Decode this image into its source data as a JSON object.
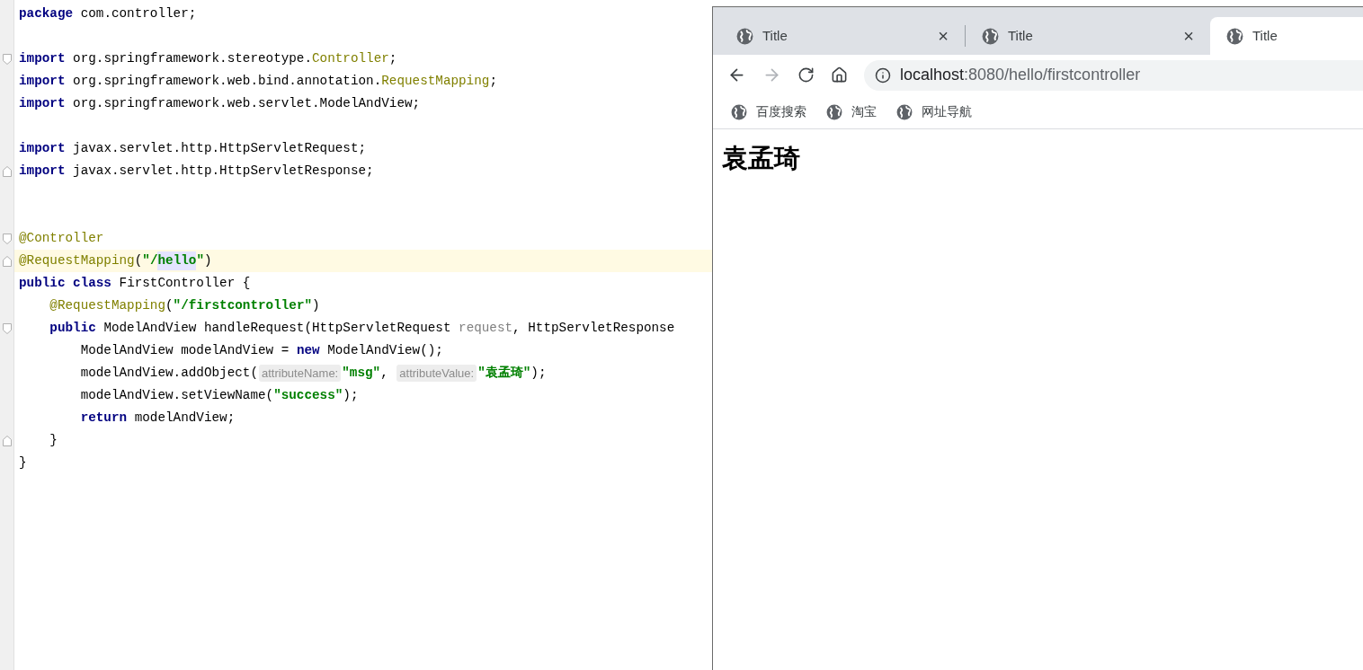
{
  "editor": {
    "lines": [
      {
        "kind": "code",
        "tokens": [
          {
            "kind": "kw",
            "text": "package"
          },
          {
            "kind": "plain",
            "text": " com.controller;"
          }
        ]
      },
      {
        "kind": "blank"
      },
      {
        "kind": "code",
        "fold_start": true,
        "tokens": [
          {
            "kind": "kw",
            "text": "import"
          },
          {
            "kind": "plain",
            "text": " org.springframework.stereotype."
          },
          {
            "kind": "ann",
            "text": "Controller"
          },
          {
            "kind": "plain",
            "text": ";"
          }
        ]
      },
      {
        "kind": "code",
        "tokens": [
          {
            "kind": "kw",
            "text": "import"
          },
          {
            "kind": "plain",
            "text": " org.springframework.web.bind.annotation."
          },
          {
            "kind": "ann",
            "text": "RequestMapping"
          },
          {
            "kind": "plain",
            "text": ";"
          }
        ]
      },
      {
        "kind": "code",
        "tokens": [
          {
            "kind": "kw",
            "text": "import"
          },
          {
            "kind": "plain",
            "text": " org.springframework.web.servlet.ModelAndView;"
          }
        ]
      },
      {
        "kind": "blank"
      },
      {
        "kind": "code",
        "tokens": [
          {
            "kind": "kw",
            "text": "import"
          },
          {
            "kind": "plain",
            "text": " javax.servlet.http.HttpServletRequest;"
          }
        ]
      },
      {
        "kind": "code",
        "fold_end": true,
        "tokens": [
          {
            "kind": "kw",
            "text": "import"
          },
          {
            "kind": "plain",
            "text": " javax.servlet.http.HttpServletResponse;"
          }
        ]
      },
      {
        "kind": "blank"
      },
      {
        "kind": "blank"
      },
      {
        "kind": "code",
        "fold_start": true,
        "tokens": [
          {
            "kind": "ann",
            "text": "@Controller"
          }
        ]
      },
      {
        "kind": "code",
        "fold_end": true,
        "current": true,
        "tokens": [
          {
            "kind": "ann",
            "text": "@RequestMapping"
          },
          {
            "kind": "plain",
            "text": "("
          },
          {
            "kind": "str",
            "text": "\"/"
          },
          {
            "kind": "match",
            "text": "hello"
          },
          {
            "kind": "str",
            "text": "\""
          },
          {
            "kind": "plain",
            "text": ")"
          }
        ]
      },
      {
        "kind": "code",
        "tokens": [
          {
            "kind": "kw",
            "text": "public class"
          },
          {
            "kind": "plain",
            "text": " FirstController {"
          }
        ]
      },
      {
        "kind": "code",
        "tokens": [
          {
            "kind": "ann",
            "text": "    @RequestMapping"
          },
          {
            "kind": "plain",
            "text": "("
          },
          {
            "kind": "str",
            "text": "\"/firstcontroller\""
          },
          {
            "kind": "plain",
            "text": ")"
          }
        ]
      },
      {
        "kind": "code",
        "fold_start": true,
        "tokens": [
          {
            "kind": "kw",
            "text": "    public"
          },
          {
            "kind": "plain",
            "text": " ModelAndView handleRequest(HttpServletRequest "
          },
          {
            "kind": "param",
            "text": "request"
          },
          {
            "kind": "plain",
            "text": ", HttpServletResponse"
          }
        ]
      },
      {
        "kind": "code",
        "tokens": [
          {
            "kind": "plain",
            "text": "        ModelAndView modelAndView = "
          },
          {
            "kind": "kw",
            "text": "new"
          },
          {
            "kind": "plain",
            "text": " ModelAndView();"
          }
        ]
      },
      {
        "kind": "code",
        "tokens": [
          {
            "kind": "plain",
            "text": "        modelAndView.addObject("
          },
          {
            "kind": "hint",
            "text": "attributeName:"
          },
          {
            "kind": "str",
            "text": "\"msg\""
          },
          {
            "kind": "plain",
            "text": ", "
          },
          {
            "kind": "hint",
            "text": "attributeValue:"
          },
          {
            "kind": "str",
            "text": "\"袁孟琦\""
          },
          {
            "kind": "plain",
            "text": ");"
          }
        ]
      },
      {
        "kind": "code",
        "tokens": [
          {
            "kind": "plain",
            "text": "        modelAndView.setViewName("
          },
          {
            "kind": "str",
            "text": "\"success\""
          },
          {
            "kind": "plain",
            "text": ");"
          }
        ]
      },
      {
        "kind": "code",
        "tokens": [
          {
            "kind": "kw",
            "text": "        return"
          },
          {
            "kind": "plain",
            "text": " modelAndView;"
          }
        ]
      },
      {
        "kind": "code",
        "fold_end": true,
        "tokens": [
          {
            "kind": "plain",
            "text": "    }"
          }
        ]
      },
      {
        "kind": "code",
        "tokens": [
          {
            "kind": "plain",
            "text": "}"
          }
        ]
      }
    ]
  },
  "browser": {
    "tabs": [
      {
        "title": "Title",
        "selected": false,
        "close": "×"
      },
      {
        "title": "Title",
        "selected": false,
        "close": "×"
      },
      {
        "title": "Title",
        "selected": true
      }
    ],
    "nav": {
      "back_disabled": false,
      "forward_disabled": true
    },
    "address": {
      "host": "localhost",
      "rest": ":8080/hello/firstcontroller"
    },
    "bookmarks": [
      {
        "label": "百度搜索"
      },
      {
        "label": "淘宝"
      },
      {
        "label": "网址导航"
      }
    ],
    "page": {
      "heading": "袁孟琦"
    }
  }
}
